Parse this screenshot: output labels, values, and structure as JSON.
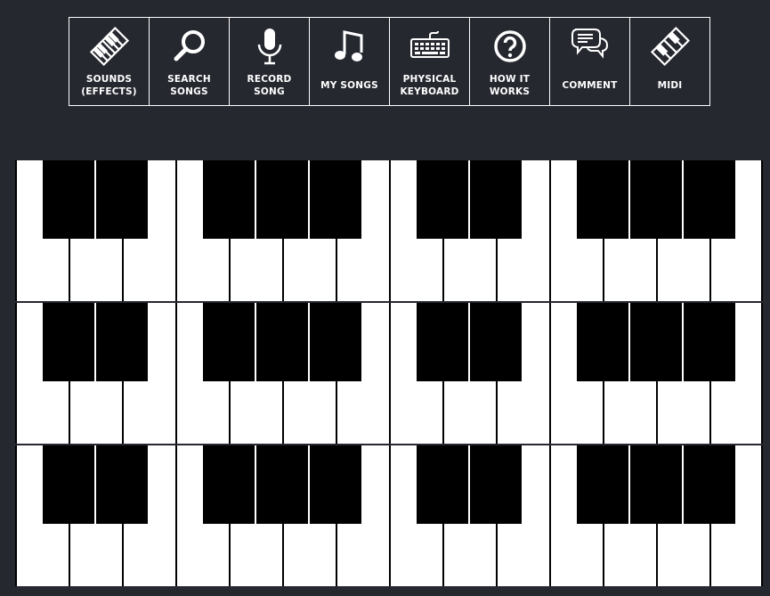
{
  "toolbar": {
    "buttons": [
      {
        "id": "sounds",
        "label": "SOUNDS\n(EFFECTS)",
        "icon": "piano-icon"
      },
      {
        "id": "search",
        "label": "SEARCH\nSONGS",
        "icon": "search-icon"
      },
      {
        "id": "record",
        "label": "RECORD\nSONG",
        "icon": "microphone-icon"
      },
      {
        "id": "my-songs",
        "label": "MY SONGS",
        "icon": "music-note-icon"
      },
      {
        "id": "physical-keyboard",
        "label": "PHYSICAL\nKEYBOARD",
        "icon": "keyboard-icon"
      },
      {
        "id": "how-it-works",
        "label": "HOW IT\nWORKS",
        "icon": "question-icon"
      },
      {
        "id": "comment",
        "label": "COMMENT",
        "icon": "comment-icon"
      },
      {
        "id": "midi",
        "label": "MIDI",
        "icon": "midi-piano-icon"
      }
    ]
  },
  "keyboard": {
    "rows": 3,
    "octaves_per_row": 2,
    "white_key_color": "#ffffff",
    "black_key_color": "#000000"
  },
  "colors": {
    "background": "#262830",
    "foreground": "#ffffff"
  }
}
